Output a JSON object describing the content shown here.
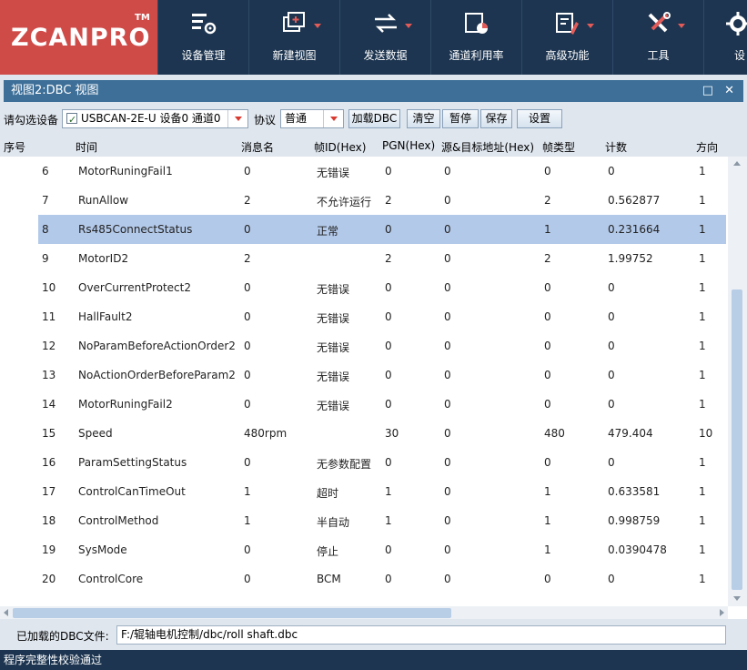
{
  "brand": {
    "name": "ZCANPRO",
    "tm": "TM"
  },
  "toolbar": [
    {
      "label": "设备管理",
      "icon": "device-manage-icon",
      "dropdown": false
    },
    {
      "label": "新建视图",
      "icon": "new-view-icon",
      "dropdown": true
    },
    {
      "label": "发送数据",
      "icon": "send-data-icon",
      "dropdown": true
    },
    {
      "label": "通道利用率",
      "icon": "channel-usage-icon",
      "dropdown": false
    },
    {
      "label": "高级功能",
      "icon": "advanced-icon",
      "dropdown": true
    },
    {
      "label": "工具",
      "icon": "tools-icon",
      "dropdown": true
    },
    {
      "label": "设",
      "icon": "settings-gear-icon",
      "dropdown": false
    }
  ],
  "panel": {
    "title": "视图2:DBC 视图",
    "restore": "□",
    "close": "✕"
  },
  "device_row": {
    "select_label": "请勾选设备",
    "device_value": "USBCAN-2E-U 设备0 通道0",
    "protocol_label": "协议",
    "protocol_value": "普通",
    "buttons": {
      "load_dbc": "加载DBC",
      "clear": "清空",
      "pause": "暂停",
      "save": "保存",
      "settings": "设置"
    }
  },
  "table": {
    "columns": [
      "序号",
      "时间",
      "消息名",
      "帧ID(Hex)",
      "PGN(Hex)",
      "源&目标地址(Hex)",
      "帧类型",
      "计数",
      "方向"
    ],
    "rows": [
      [
        "6",
        "MotorRuningFail1",
        "0",
        "无错误",
        "0",
        "0",
        "0",
        "0",
        "1"
      ],
      [
        "7",
        "RunAllow",
        "2",
        "不允许运行",
        "2",
        "0",
        "2",
        "0.562877",
        "1"
      ],
      [
        "8",
        "Rs485ConnectStatus",
        "0",
        "正常",
        "0",
        "0",
        "1",
        "0.231664",
        "1"
      ],
      [
        "9",
        "MotorID2",
        "2",
        "",
        "2",
        "0",
        "2",
        "1.99752",
        "1"
      ],
      [
        "10",
        "OverCurrentProtect2",
        "0",
        "无错误",
        "0",
        "0",
        "0",
        "0",
        "1"
      ],
      [
        "11",
        "HallFault2",
        "0",
        "无错误",
        "0",
        "0",
        "0",
        "0",
        "1"
      ],
      [
        "12",
        "NoParamBeforeActionOrder2",
        "0",
        "无错误",
        "0",
        "0",
        "0",
        "0",
        "1"
      ],
      [
        "13",
        "NoActionOrderBeforeParam2",
        "0",
        "无错误",
        "0",
        "0",
        "0",
        "0",
        "1"
      ],
      [
        "14",
        "MotorRuningFail2",
        "0",
        "无错误",
        "0",
        "0",
        "0",
        "0",
        "1"
      ],
      [
        "15",
        "Speed",
        "480rpm",
        "",
        "30",
        "0",
        "480",
        "479.404",
        "10"
      ],
      [
        "16",
        "ParamSettingStatus",
        "0",
        "无参数配置",
        "0",
        "0",
        "0",
        "0",
        "1"
      ],
      [
        "17",
        "ControlCanTimeOut",
        "1",
        "超时",
        "1",
        "0",
        "1",
        "0.633581",
        "1"
      ],
      [
        "18",
        "ControlMethod",
        "1",
        "半自动",
        "1",
        "0",
        "1",
        "0.998759",
        "1"
      ],
      [
        "19",
        "SysMode",
        "0",
        "停止",
        "0",
        "0",
        "1",
        "0.0390478",
        "1"
      ],
      [
        "20",
        "ControlCore",
        "0",
        "BCM",
        "0",
        "0",
        "0",
        "0",
        "1"
      ]
    ],
    "selected_index": 2
  },
  "dbc_file": {
    "label": "已加载的DBC文件:",
    "path": "F:/辊轴电机控制/dbc/roll shaft.dbc"
  },
  "status": "程序完整性校验通过",
  "colors": {
    "topbar": "#1d3550",
    "logo": "#cf4b48",
    "panel_header": "#3d6f98",
    "selected_row": "#b3c9e9"
  }
}
